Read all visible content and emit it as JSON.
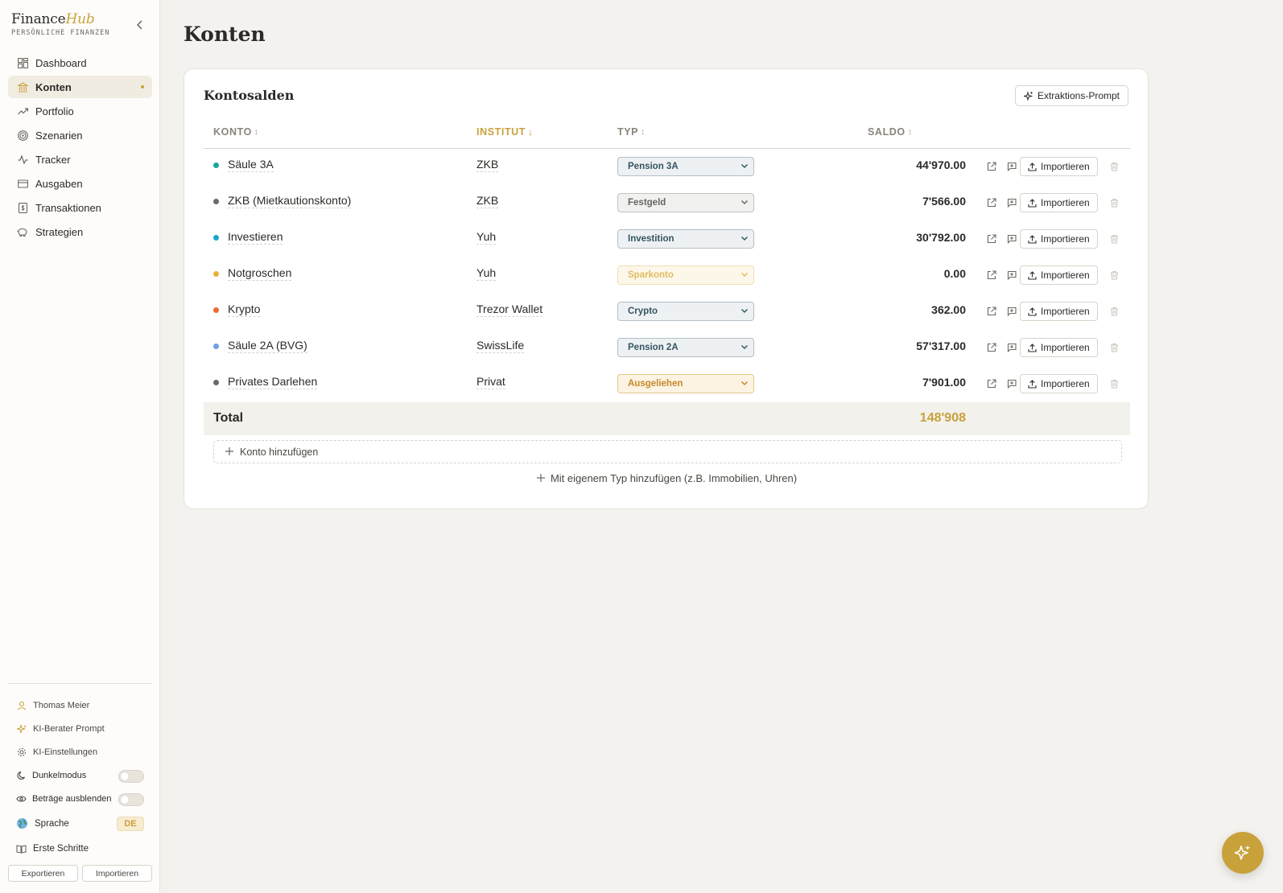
{
  "brand": {
    "name_plain": "Finance",
    "name_accent": "Hub",
    "subtitle": "PERSÖNLICHE FINANZEN"
  },
  "nav": {
    "items": [
      {
        "label": "Dashboard",
        "icon": "dashboard-icon"
      },
      {
        "label": "Konten",
        "icon": "bank-icon",
        "active": true
      },
      {
        "label": "Portfolio",
        "icon": "trend-icon"
      },
      {
        "label": "Szenarien",
        "icon": "target-icon"
      },
      {
        "label": "Tracker",
        "icon": "pulse-icon"
      },
      {
        "label": "Ausgaben",
        "icon": "card-icon"
      },
      {
        "label": "Transaktionen",
        "icon": "receipt-icon"
      },
      {
        "label": "Strategien",
        "icon": "piggy-bank-icon"
      }
    ]
  },
  "sidebar_bottom": {
    "user": "Thomas Meier",
    "ai_prompt": "KI-Berater Prompt",
    "ai_settings": "KI-Einstellungen",
    "dark_mode": "Dunkelmodus",
    "hide_amounts": "Beträge ausblenden",
    "language_label": "Sprache",
    "language_value": "DE",
    "getting_started": "Erste Schritte",
    "export_label": "Exportieren",
    "import_label": "Importieren"
  },
  "page": {
    "title": "Konten"
  },
  "card": {
    "title": "Kontosalden",
    "extract_button": "Extraktions-Prompt",
    "columns": {
      "konto": "KONTO",
      "institut": "INSTITUT",
      "typ": "TYP",
      "saldo": "SALDO"
    },
    "sort_column": "INSTITUT",
    "rows": [
      {
        "name": "Säule 3A",
        "dot_color": "#14a89b",
        "institut": "ZKB",
        "typ": "Pension 3A",
        "typ_style": "blue",
        "saldo": "44'970.00"
      },
      {
        "name": "ZKB (Mietkautionskonto)",
        "dot_color": "#6b6b6b",
        "institut": "ZKB",
        "typ": "Festgeld",
        "typ_style": "gray",
        "saldo": "7'566.00"
      },
      {
        "name": "Investieren",
        "dot_color": "#1aa6c9",
        "institut": "Yuh",
        "typ": "Investition",
        "typ_style": "blue",
        "saldo": "30'792.00"
      },
      {
        "name": "Notgroschen",
        "dot_color": "#e6b33a",
        "institut": "Yuh",
        "typ": "Sparkonto",
        "typ_style": "sand",
        "saldo": "0.00"
      },
      {
        "name": "Krypto",
        "dot_color": "#ea6a35",
        "institut": "Trezor Wallet",
        "typ": "Crypto",
        "typ_style": "blue",
        "saldo": "362.00"
      },
      {
        "name": "Säule 2A (BVG)",
        "dot_color": "#6f9fe0",
        "institut": "SwissLife",
        "typ": "Pension 2A",
        "typ_style": "blue",
        "saldo": "57'317.00"
      },
      {
        "name": "Privates Darlehen",
        "dot_color": "#6b6b6b",
        "institut": "Privat",
        "typ": "Ausgeliehen",
        "typ_style": "gold",
        "saldo": "7'901.00"
      }
    ],
    "import_label": "Importieren",
    "total_label": "Total",
    "total_value": "148'908",
    "add_account": "Konto hinzufügen",
    "add_custom": "Mit eigenem Typ hinzufügen (z.B. Immobilien, Uhren)"
  },
  "colors": {
    "accent": "#c9a13b",
    "background": "#f4f2ee"
  }
}
